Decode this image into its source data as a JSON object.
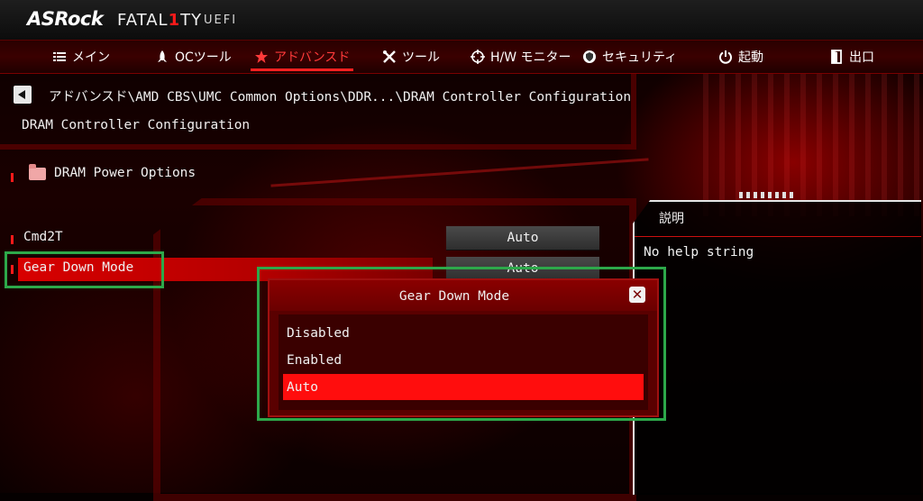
{
  "header": {
    "brand": "ASRock",
    "product_pre": "FATAL",
    "product_one": "1",
    "product_post": "TY",
    "uefi": "UEFI"
  },
  "nav": {
    "tabs": [
      {
        "label": "メイン",
        "icon": "list-icon"
      },
      {
        "label": "OCツール",
        "icon": "rocket-icon"
      },
      {
        "label": "アドバンスド",
        "icon": "star-icon",
        "active": true
      },
      {
        "label": "ツール",
        "icon": "tools-icon"
      },
      {
        "label": "H/W モニター",
        "icon": "crosshair-icon"
      },
      {
        "label": "セキュリティ",
        "icon": "shield-icon"
      },
      {
        "label": "起動",
        "icon": "power-icon"
      },
      {
        "label": "出口",
        "icon": "exit-door-icon"
      }
    ]
  },
  "breadcrumb": "アドバンスド\\AMD CBS\\UMC Common Options\\DDR...\\DRAM Controller Configuration",
  "page_title": "DRAM Controller Configuration",
  "items": {
    "dram_power": "DRAM Power Options",
    "cmd2t": {
      "label": "Cmd2T",
      "value": "Auto"
    },
    "gear_down": {
      "label": "Gear Down Mode",
      "value": "Auto"
    }
  },
  "help": {
    "title": "説明",
    "text": "No help string"
  },
  "popup": {
    "title": "Gear Down Mode",
    "options": [
      "Disabled",
      "Enabled",
      "Auto"
    ],
    "selected": "Auto"
  },
  "colors": {
    "accent": "#ff1a1a",
    "highlight_outline": "#2da84a"
  }
}
